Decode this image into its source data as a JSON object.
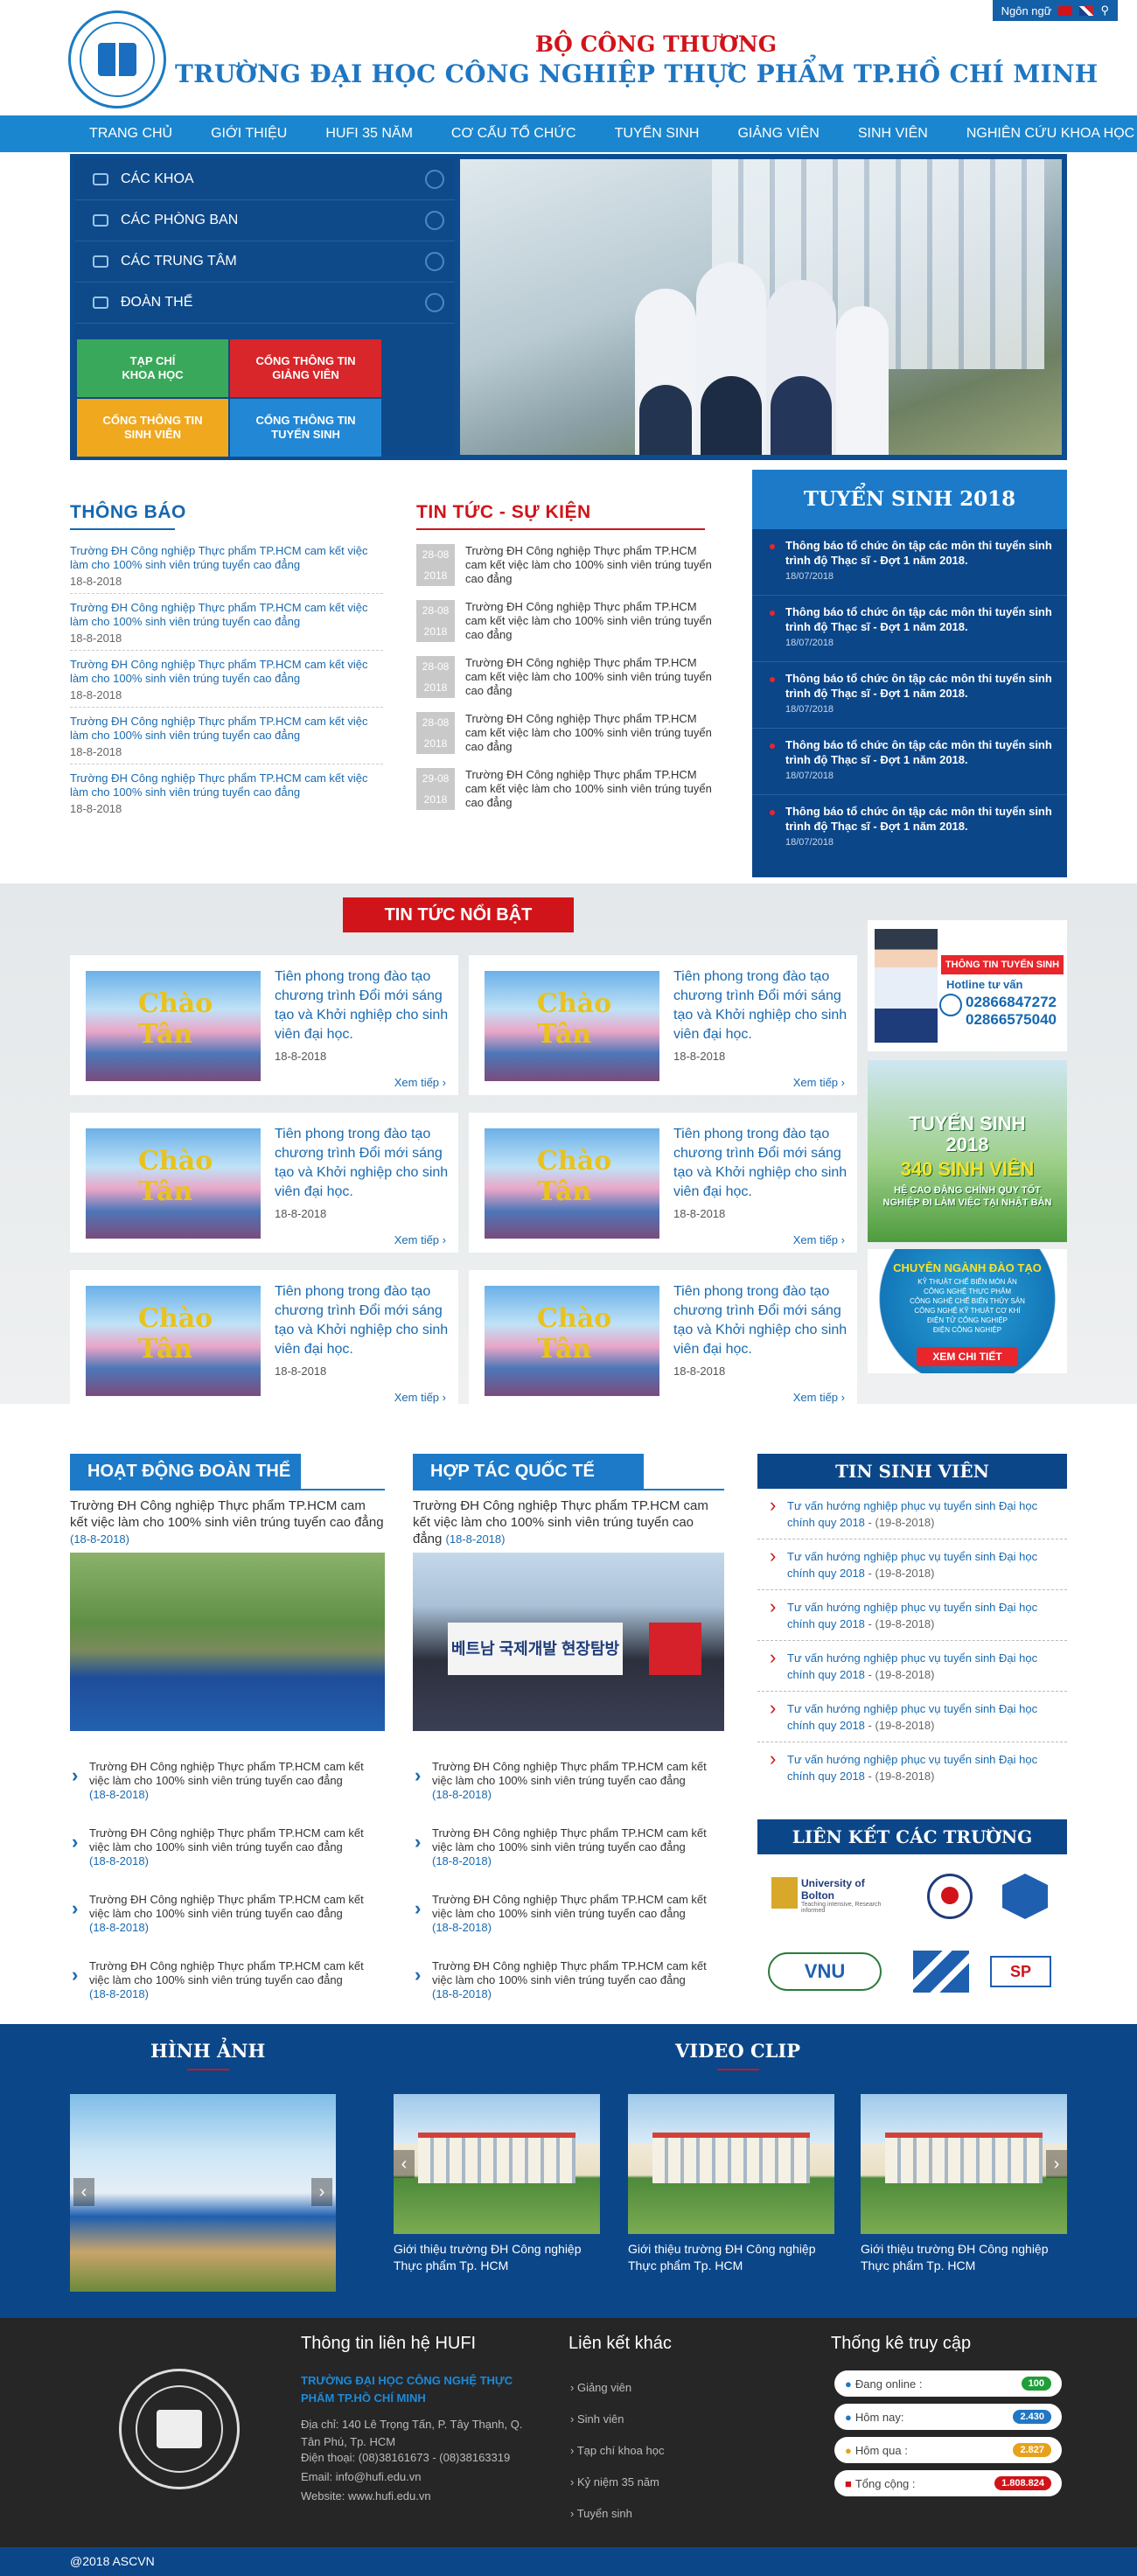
{
  "topbar": {
    "language_label": "Ngôn ngữ"
  },
  "header": {
    "ministry": "BỘ CÔNG THƯƠNG",
    "university": "TRƯỜNG ĐẠI HỌC CÔNG NGHIỆP THỰC PHẨM TP.HỒ CHÍ MINH"
  },
  "nav": [
    "TRANG CHỦ",
    "GIỚI THIỆU",
    "HUFI 35 NĂM",
    "CƠ CẤU TỔ CHỨC",
    "TUYỂN SINH",
    "GIẢNG VIÊN",
    "SINH VIÊN",
    "NGHIÊN CỨU KHOA HỌC"
  ],
  "sidebar": {
    "items": [
      "CÁC KHOA",
      "CÁC PHÒNG BAN",
      "CÁC TRUNG TÂM",
      "ĐOÀN THỂ"
    ],
    "tiles": [
      "TẠP CHÍ KHOA HỌC",
      "CỔNG THÔNG TIN GIẢNG VIÊN",
      "CỔNG THÔNG TIN SINH VIÊN",
      "CỔNG THÔNG TIN TUYỂN SINH"
    ]
  },
  "notices": {
    "title": "THÔNG BÁO",
    "items": [
      {
        "text": "Trường ĐH Công nghiệp Thực phẩm TP.HCM cam kết việc làm cho 100% sinh viên trúng tuyển cao đẳng",
        "date": "18-8-2018"
      },
      {
        "text": "Trường ĐH Công nghiệp Thực phẩm TP.HCM cam kết việc làm cho 100% sinh viên trúng tuyển cao đẳng",
        "date": "18-8-2018"
      },
      {
        "text": "Trường ĐH Công nghiệp Thực phẩm TP.HCM cam kết việc làm cho 100% sinh viên trúng tuyển cao đẳng",
        "date": "18-8-2018"
      },
      {
        "text": "Trường ĐH Công nghiệp Thực phẩm TP.HCM cam kết việc làm cho 100% sinh viên trúng tuyển cao đẳng",
        "date": "18-8-2018"
      },
      {
        "text": "Trường ĐH Công nghiệp Thực phẩm TP.HCM cam kết việc làm cho 100% sinh viên trúng tuyển cao đẳng",
        "date": "18-8-2018"
      }
    ]
  },
  "news": {
    "title": "TIN TỨC - SỰ KIỆN",
    "items": [
      {
        "day": "28-08",
        "year": "2018",
        "text": "Trường ĐH Công nghiệp Thực phẩm TP.HCM cam kết việc làm cho 100% sinh viên trúng tuyển cao đẳng"
      },
      {
        "day": "28-08",
        "year": "2018",
        "text": "Trường ĐH Công nghiệp Thực phẩm TP.HCM cam kết việc làm cho 100% sinh viên trúng tuyển cao đẳng"
      },
      {
        "day": "28-08",
        "year": "2018",
        "text": "Trường ĐH Công nghiệp Thực phẩm TP.HCM cam kết việc làm cho 100% sinh viên trúng tuyển cao đẳng"
      },
      {
        "day": "28-08",
        "year": "2018",
        "text": "Trường ĐH Công nghiệp Thực phẩm TP.HCM cam kết việc làm cho 100% sinh viên trúng tuyển cao đẳng"
      },
      {
        "day": "29-08",
        "year": "2018",
        "text": "Trường ĐH Công nghiệp Thực phẩm TP.HCM cam kết việc làm cho 100% sinh viên trúng tuyển cao đẳng"
      }
    ]
  },
  "admissions": {
    "title": "TUYỂN SINH 2018",
    "items": [
      {
        "text": "Thông báo tổ chức ôn tập các môn thi tuyển sinh trình độ Thạc sĩ - Đợt 1 năm 2018.",
        "date": "18/07/2018"
      },
      {
        "text": "Thông báo tổ chức ôn tập các môn thi tuyển sinh trình độ Thạc sĩ - Đợt 1 năm 2018.",
        "date": "18/07/2018"
      },
      {
        "text": "Thông báo tổ chức ôn tập các môn thi tuyển sinh trình độ Thạc sĩ - Đợt 1 năm 2018.",
        "date": "18/07/2018"
      },
      {
        "text": "Thông báo tổ chức ôn tập các môn thi tuyển sinh trình độ Thạc sĩ - Đợt 1 năm 2018.",
        "date": "18/07/2018"
      },
      {
        "text": "Thông báo tổ chức ôn tập các môn thi tuyển sinh trình độ Thạc sĩ - Đợt 1 năm 2018.",
        "date": "18/07/2018"
      }
    ]
  },
  "featured": {
    "title": "TIN TỨC NỔI BẬT",
    "card": {
      "text": "Tiên phong trong đào tạo chương trình Đổi mới sáng tạo và Khởi nghiệp cho sinh viên đại học.",
      "date": "18-8-2018",
      "more": "Xem tiếp"
    },
    "img_text": "Chào Tân"
  },
  "banners": {
    "b1": {
      "title": "THÔNG TIN TUYỂN SINH",
      "hotline": "Hotline tư vấn",
      "p1": "02866847272",
      "p2": "02866575040"
    },
    "b2": {
      "t1": "TUYỂN SINH",
      "t2": "2018",
      "t3": "340 SINH VIÊN",
      "t4": "HỆ CAO ĐẲNG CHÍNH QUY TỐT NGHIỆP ĐI LÀM VIỆC TẠI NHẬT BẢN"
    },
    "b3": {
      "title": "CHUYÊN NGÀNH ĐÀO TẠO",
      "lines": [
        "KỸ THUẬT CHẾ BIẾN MÓN ĂN",
        "CÔNG NGHỆ THỰC PHẨM",
        "CÔNG NGHỆ CHẾ BIẾN THỦY SẢN",
        "CÔNG NGHỆ KỸ THUẬT CƠ KHÍ",
        "ĐIỆN TỬ CÔNG NGHIỆP",
        "ĐIỆN CÔNG NGHIỆP"
      ],
      "btn": "XEM CHI TIẾT"
    }
  },
  "union": {
    "title": "HOẠT ĐỘNG ĐOÀN THỂ",
    "lead": "Trường ĐH Công nghiệp Thực phẩm TP.HCM cam kết việc làm cho 100% sinh viên trúng tuyển cao đẳng",
    "lead_date": "(18-8-2018)",
    "items": [
      "Trường ĐH Công nghiệp Thực phẩm TP.HCM cam kết việc làm cho 100% sinh viên trúng tuyển cao đẳng",
      "Trường ĐH Công nghiệp Thực phẩm TP.HCM cam kết việc làm cho 100% sinh viên trúng tuyển cao đẳng",
      "Trường ĐH Công nghiệp Thực phẩm TP.HCM cam kết việc làm cho 100% sinh viên trúng tuyển cao đẳng",
      "Trường ĐH Công nghiệp Thực phẩm TP.HCM cam kết việc làm cho 100% sinh viên trúng tuyển cao đẳng"
    ],
    "item_date": "(18-8-2018)"
  },
  "intl": {
    "title": "HỢP TÁC QUỐC TẾ",
    "lead": "Trường ĐH Công nghiệp Thực phẩm TP.HCM cam kết việc làm cho 100% sinh viên trúng tuyển cao đẳng",
    "lead_date": "(18-8-2018)",
    "banner_text": "베트남 국제개발 현장탐방",
    "items": [
      "Trường ĐH Công nghiệp Thực phẩm TP.HCM cam kết việc làm cho 100% sinh viên trúng tuyển cao đẳng",
      "Trường ĐH Công nghiệp Thực phẩm TP.HCM cam kết việc làm cho 100% sinh viên trúng tuyển cao đẳng",
      "Trường ĐH Công nghiệp Thực phẩm TP.HCM cam kết việc làm cho 100% sinh viên trúng tuyển cao đẳng",
      "Trường ĐH Công nghiệp Thực phẩm TP.HCM cam kết việc làm cho 100% sinh viên trúng tuyển cao đẳng"
    ],
    "item_date": "(18-8-2018)"
  },
  "student_news": {
    "title": "TIN SINH VIÊN",
    "items": [
      {
        "text": "Tư vấn hướng nghiệp phục vụ tuyển sinh Đại học chính quy 2018",
        "date": "- (19-8-2018)"
      },
      {
        "text": "Tư vấn hướng nghiệp phục vụ tuyển sinh Đại học chính quy 2018",
        "date": "- (19-8-2018)"
      },
      {
        "text": "Tư vấn hướng nghiệp phục vụ tuyển sinh Đại học chính quy 2018",
        "date": "- (19-8-2018)"
      },
      {
        "text": "Tư vấn hướng nghiệp phục vụ tuyển sinh Đại học chính quy 2018",
        "date": "- (19-8-2018)"
      },
      {
        "text": "Tư vấn hướng nghiệp phục vụ tuyển sinh Đại học chính quy 2018",
        "date": "- (19-8-2018)"
      },
      {
        "text": "Tư vấn hướng nghiệp phục vụ tuyển sinh Đại học chính quy 2018",
        "date": "- (19-8-2018)"
      }
    ]
  },
  "links": {
    "title": "LIÊN KẾT CÁC TRƯỜNG",
    "bolton": "University of Bolton",
    "bolton_sub": "Teaching intensive, Research informed",
    "vnu": "VNU",
    "sp": "SP"
  },
  "media": {
    "photo_title": "HÌNH ẢNH",
    "video_title": "VIDEO CLIP",
    "video_caption": "Giới thiệu trường ĐH Công nghiệp Thực phẩm Tp. HCM"
  },
  "footer": {
    "contact_title": "Thông tin liên hệ HUFI",
    "org": "TRƯỜNG ĐẠI HỌC CÔNG NGHỆ THỰC PHẨM TP.HỒ CHÍ MINH",
    "address": "Địa chỉ: 140 Lê Trọng Tấn, P. Tây Thạnh, Q. Tân Phú, Tp. HCM",
    "phone": "Điện thoại: (08)38161673 - (08)38163319",
    "email": "Email: info@hufi.edu.vn",
    "website": "Website: www.hufi.edu.vn",
    "links_title": "Liên kết khác",
    "links": [
      "Giảng viên",
      "Sinh viên",
      "Tạp chí khoa học",
      "Kỷ niệm 35 năm",
      "Tuyển sinh"
    ],
    "stats_title": "Thống kê truy cập",
    "stats": [
      {
        "label": "Đang online :",
        "value": "100",
        "color": "#1f9e3a"
      },
      {
        "label": "Hôm nay:",
        "value": "2.430",
        "color": "#2177c3"
      },
      {
        "label": "Hôm qua :",
        "value": "2.827",
        "color": "#e6a21c"
      },
      {
        "label": "Tổng cộng :",
        "value": "1.808.824",
        "color": "#d0141a"
      }
    ],
    "copyright": "@2018 ASCVN"
  }
}
